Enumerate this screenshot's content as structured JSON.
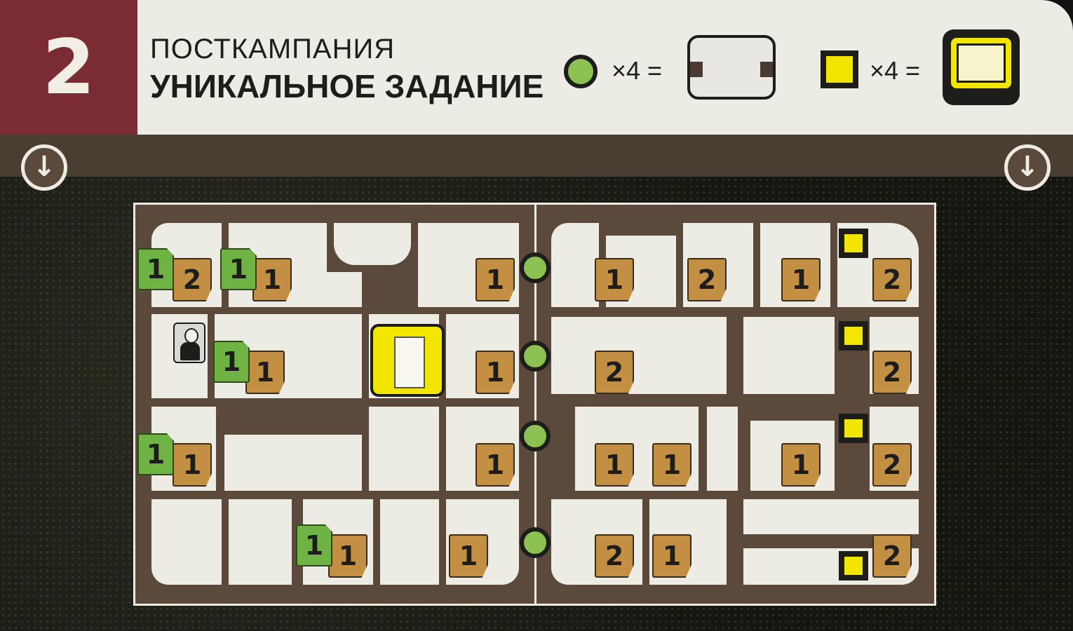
{
  "mission_number": "2",
  "header": {
    "subtitle": "ПОСТКАМПАНИЯ",
    "title": "УНИКАЛЬНОЕ ЗАДАНИЕ"
  },
  "legend": [
    {
      "marker": "green-circle",
      "text": "×4 =",
      "tile": "door-barrier-tile"
    },
    {
      "marker": "yellow-square",
      "text": "×4 =",
      "tile": "safe-tile"
    }
  ],
  "colors": {
    "banner": "#7a2b33",
    "header_bg": "#ecebe4",
    "floor": "#ecebe4",
    "wall": "#5b4a3b",
    "token_tan": "#c28f43",
    "token_green": "#6fb345",
    "marker_green": "#8dc152",
    "marker_yellow": "#f2e600"
  },
  "icons": {
    "arrow": "arrow-down-icon",
    "door": "door-icon",
    "safe": "safe-icon",
    "boss": "boss-figure-icon"
  },
  "tokens": {
    "green": [
      "1",
      "1",
      "1",
      "1",
      "1"
    ],
    "tan": [
      "2",
      "1",
      "1",
      "1",
      "1",
      "1",
      "1",
      "1",
      "1",
      "1",
      "1",
      "2",
      "1",
      "2",
      "2",
      "2",
      "1",
      "1",
      "1",
      "2",
      "2",
      "1",
      "2"
    ]
  }
}
